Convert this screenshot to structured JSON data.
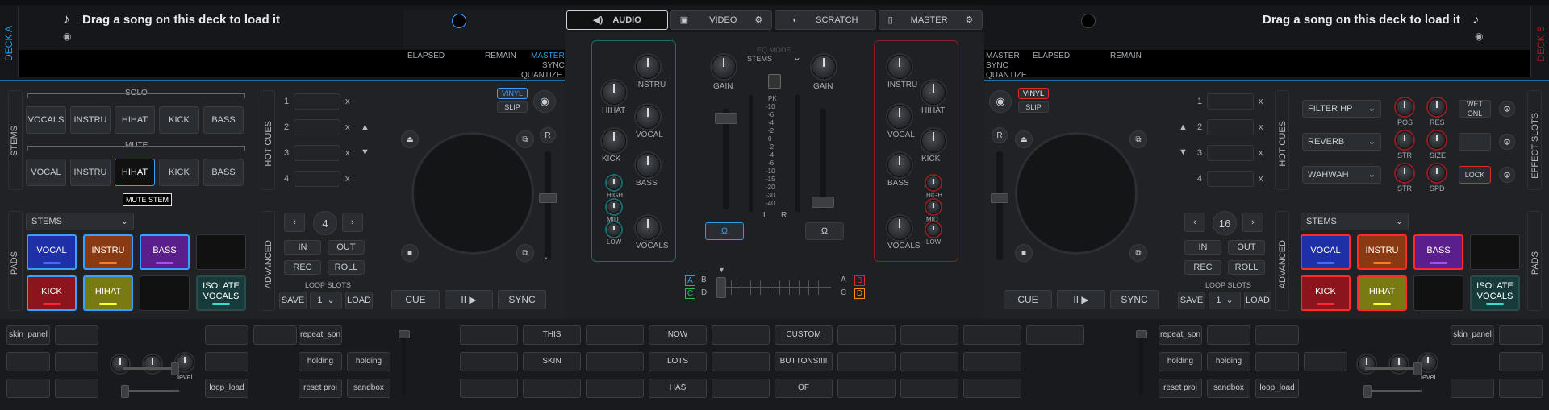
{
  "deck_a": {
    "title": "DECK A",
    "load_text": "Drag a song on this deck to load it",
    "elapsed": "ELAPSED",
    "remain": "REMAIN",
    "master": "MASTER",
    "sync": "SYNC",
    "quantize": "QUANTIZE",
    "stems_side": "STEMS",
    "solo_label": "SOLO",
    "mute_label": "MUTE",
    "solo": [
      "VOCALS",
      "INSTRU",
      "HIHAT",
      "KICK",
      "BASS"
    ],
    "mute": [
      "VOCAL",
      "INSTRU",
      "HIHAT",
      "KICK",
      "BASS"
    ],
    "tooltip": "MUTE STEM",
    "hot_cues_side": "HOT CUES",
    "hot_cues": [
      "1",
      "2",
      "3",
      "4"
    ],
    "hot_cue_clear": "x",
    "vinyl": "VINYL",
    "slip": "SLIP",
    "pads_side": "PADS",
    "pads_mode": "STEMS",
    "pads": [
      {
        "label": "VOCAL",
        "bg": "#1f2fa8",
        "border": "#3aa0ff",
        "bar": "#3f6bff"
      },
      {
        "label": "INSTRU",
        "bg": "#8a3a12",
        "border": "#3aa0ff",
        "bar": "#ff7a1a"
      },
      {
        "label": "BASS",
        "bg": "#5a1f8c",
        "border": "#3aa0ff",
        "bar": "#b04cff"
      },
      {
        "label": "KICK",
        "bg": "#8c141c",
        "border": "#3aa0ff",
        "bar": "#ff2a2a"
      },
      {
        "label": "HIHAT",
        "bg": "#7a7a12",
        "border": "#3aa0ff",
        "bar": "#ffff33"
      },
      {
        "label": "ISOLATE VOCALS",
        "bg": "#173b3a",
        "border": "#2a4b4a",
        "bar": "#33dddd"
      }
    ],
    "advanced_side": "ADVANCED",
    "loop_size": "4",
    "in": "IN",
    "out": "OUT",
    "rec": "REC",
    "roll": "ROLL",
    "loop_slots": "LOOP SLOTS",
    "save": "SAVE",
    "slot_num": "1",
    "load": "LOAD",
    "cue": "CUE",
    "play": "II ▶",
    "sync_btn": "SYNC"
  },
  "deck_b": {
    "title": "DECK B",
    "load_text": "Drag a song on this deck to load it",
    "elapsed": "ELAPSED",
    "remain": "REMAIN",
    "master": "MASTER",
    "sync": "SYNC",
    "quantize": "QUANTIZE",
    "hot_cues_side": "HOT CUES",
    "hot_cues": [
      "1",
      "2",
      "3",
      "4"
    ],
    "hot_cue_clear": "x",
    "vinyl": "VINYL",
    "slip": "SLIP",
    "pads_side": "PADS",
    "pads_mode": "STEMS",
    "pads": [
      {
        "label": "VOCAL",
        "bg": "#1f2fa8",
        "border": "#ff2a2a",
        "bar": "#3f6bff"
      },
      {
        "label": "INSTRU",
        "bg": "#8a3a12",
        "border": "#ff2a2a",
        "bar": "#ff7a1a"
      },
      {
        "label": "BASS",
        "bg": "#5a1f8c",
        "border": "#ff2a2a",
        "bar": "#b04cff"
      },
      {
        "label": "KICK",
        "bg": "#8c141c",
        "border": "#ff2a2a",
        "bar": "#ff2a2a"
      },
      {
        "label": "HIHAT",
        "bg": "#7a7a12",
        "border": "#ff2a2a",
        "bar": "#ffff33"
      },
      {
        "label": "ISOLATE VOCALS",
        "bg": "#173b3a",
        "border": "#2a4b4a",
        "bar": "#33dddd"
      }
    ],
    "advanced_side": "ADVANCED",
    "loop_size": "16",
    "in": "IN",
    "out": "OUT",
    "rec": "REC",
    "roll": "ROLL",
    "loop_slots": "LOOP SLOTS",
    "save": "SAVE",
    "slot_num": "1",
    "load": "LOAD",
    "cue": "CUE",
    "play": "II ▶",
    "sync_btn": "SYNC",
    "effect_slots_side": "EFFECT SLOTS",
    "effects": [
      {
        "name": "FILTER HP",
        "k1": "POS",
        "k2": "RES",
        "btn": "WET ONL"
      },
      {
        "name": "REVERB",
        "k1": "STR",
        "k2": "SIZE",
        "btn": ""
      },
      {
        "name": "WAHWAH",
        "k1": "STR",
        "k2": "SPD",
        "btn": "LOCK"
      }
    ]
  },
  "tabs": [
    {
      "label": "AUDIO",
      "icon": "speaker-icon"
    },
    {
      "label": "VIDEO",
      "icon": "video-icon"
    },
    {
      "label": "SCRATCH",
      "icon": "scratch-icon"
    },
    {
      "label": "MASTER",
      "icon": "master-icon"
    }
  ],
  "mixer": {
    "left_stems": [
      "INSTRU",
      "HIHAT",
      "VOCAL",
      "KICK",
      "BASS",
      "HIGH",
      "MID",
      "LOW",
      "VOCALS"
    ],
    "right_stems": [
      "INSTRU",
      "HIHAT",
      "VOCAL",
      "KICK",
      "BASS",
      "HIGH",
      "MID",
      "LOW",
      "VOCALS"
    ],
    "eq_mode": "EQ MODE",
    "stems": "STEMS",
    "gain": "GAIN",
    "vu_scale": [
      "PK",
      "-10",
      "-6",
      "-4",
      "-2",
      "0",
      "-2",
      "-4",
      "-6",
      "-10",
      "-15",
      "-20",
      "-30",
      "-40"
    ],
    "l": "L",
    "r": "R",
    "xf_left": [
      "A",
      "B",
      "C",
      "D"
    ],
    "xf_right": [
      "A",
      "B",
      "C",
      "D"
    ]
  },
  "bottom": {
    "left_row1": [
      "skin_panel",
      "",
      "",
      "",
      "repeat_son"
    ],
    "left_row2": [
      "",
      "",
      "",
      "holding",
      "holding"
    ],
    "left_row3": [
      "",
      "",
      "loop_load",
      "reset proj",
      "sandbox"
    ],
    "level": "level",
    "center_row1": [
      "",
      "THIS",
      "",
      "NOW",
      "",
      "CUSTOM",
      "",
      ""
    ],
    "center_row2": [
      "",
      "SKIN",
      "",
      "LOTS",
      "",
      "BUTTONS!!!!",
      ""
    ],
    "center_row3": [
      "",
      "",
      "HAS",
      "",
      "OF",
      "",
      ""
    ],
    "right_row1": [
      "repeat_son",
      "",
      "",
      "skin_panel",
      ""
    ],
    "right_row2": [
      "holding",
      "holding",
      "",
      "",
      ""
    ],
    "right_row3": [
      "reset proj",
      "sandbox",
      "loop_load",
      "",
      ""
    ]
  }
}
